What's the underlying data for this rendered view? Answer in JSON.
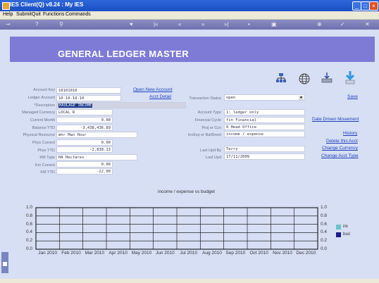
{
  "window": {
    "title": "IES Client(Q) v8.24 : My IES"
  },
  "menu": [
    "Help",
    "Submit",
    "Quit",
    "Functions",
    "Commands"
  ],
  "page_title": "GENERAL LEDGER MASTER",
  "colors": {
    "header": "#7d7bd6",
    "link": "#1f3fbf",
    "series_1": "#6ac3c8",
    "series_2": "#1a1a8e"
  },
  "toolbar_icons": [
    "key-icon",
    "help-icon",
    "search-icon",
    "heart-icon",
    "rewind-icon",
    "previous-icon",
    "next-icon",
    "fast-forward-icon",
    "delete-icon",
    "save-icon",
    "add-icon",
    "confirm-icon",
    "close-icon"
  ],
  "form": {
    "account_key": {
      "label": "Account Key",
      "value": "10101010"
    },
    "ledger_account": {
      "label": "Ledger Account",
      "value": "10-10-10-10"
    },
    "description": {
      "label": "*Description",
      "value": "HAULAGE INCOME"
    },
    "managed_currency": {
      "label": "Managed Currency",
      "value": "LOCAL R"
    },
    "current_month": {
      "label": "Current Month",
      "value": "0.00"
    },
    "balance_ytd": {
      "label": "Balance YTD",
      "value": "-3,438,436.89"
    },
    "physical_resource": {
      "label": "Physical Resource",
      "value": "mhr Man Hour"
    },
    "phys_current": {
      "label": "Phys Current",
      "value": "0.00"
    },
    "phys_ytd": {
      "label": "Phys YTD",
      "value": "-2,838.13"
    },
    "km_type": {
      "label": "KM Type",
      "value": "HA Hectares"
    },
    "km_current": {
      "label": "Km Current",
      "value": "0.00"
    },
    "km_ytd": {
      "label": "KM YTD",
      "value": "-22.00"
    },
    "transaction_status": {
      "label": "Transaction Status",
      "value": "open"
    },
    "account_type": {
      "label": "Account Type",
      "value": "1: ledger only"
    },
    "financial_cycle": {
      "label": "Financial Cycle",
      "value": "fin Financial"
    },
    "proj_or_ccn": {
      "label": "Proj or Ccn",
      "value": "0 Head Office"
    },
    "inc_exp_or_balsheet": {
      "label": "IncExp or BalSheet",
      "value": "income / expense"
    },
    "last_upd_by": {
      "label": "Last Upd By",
      "value": "Terry"
    },
    "last_upd": {
      "label": "Last Upd",
      "value": "17/11/2009"
    }
  },
  "links": {
    "open_new_account": "Open New Account",
    "acct_detail": "Acct Detail",
    "save": "Save",
    "date_driven_movement": "Date Driven Movement",
    "history": "History",
    "delete_this_acct": "Delete this Acct",
    "change_currency": "Change Currency",
    "change_acct_type": "Change Acct Type"
  },
  "chart_data": {
    "type": "bar",
    "title": "income / expense vs budget",
    "categories": [
      "Jan 2010",
      "Feb 2010",
      "Mar 2010",
      "Apr 2010",
      "May 2010",
      "Jun 2010",
      "Jul 2010",
      "Aug 2010",
      "Sep 2010",
      "Oct 2010",
      "Nov 2010",
      "Dec 2010"
    ],
    "series": [
      {
        "name": "i/e",
        "values": [
          0,
          0,
          0,
          0,
          0,
          0,
          0,
          0,
          0,
          0,
          0,
          0
        ]
      },
      {
        "name": "buc",
        "values": [
          0,
          0,
          0,
          0,
          0,
          0,
          0,
          0,
          0,
          0,
          0,
          0
        ]
      }
    ],
    "ylim": [
      0,
      1.0
    ],
    "yticks": [
      "1.0",
      "0.8",
      "0.6",
      "0.4",
      "0.2",
      "0.0"
    ],
    "grid": true,
    "legend": "right"
  }
}
